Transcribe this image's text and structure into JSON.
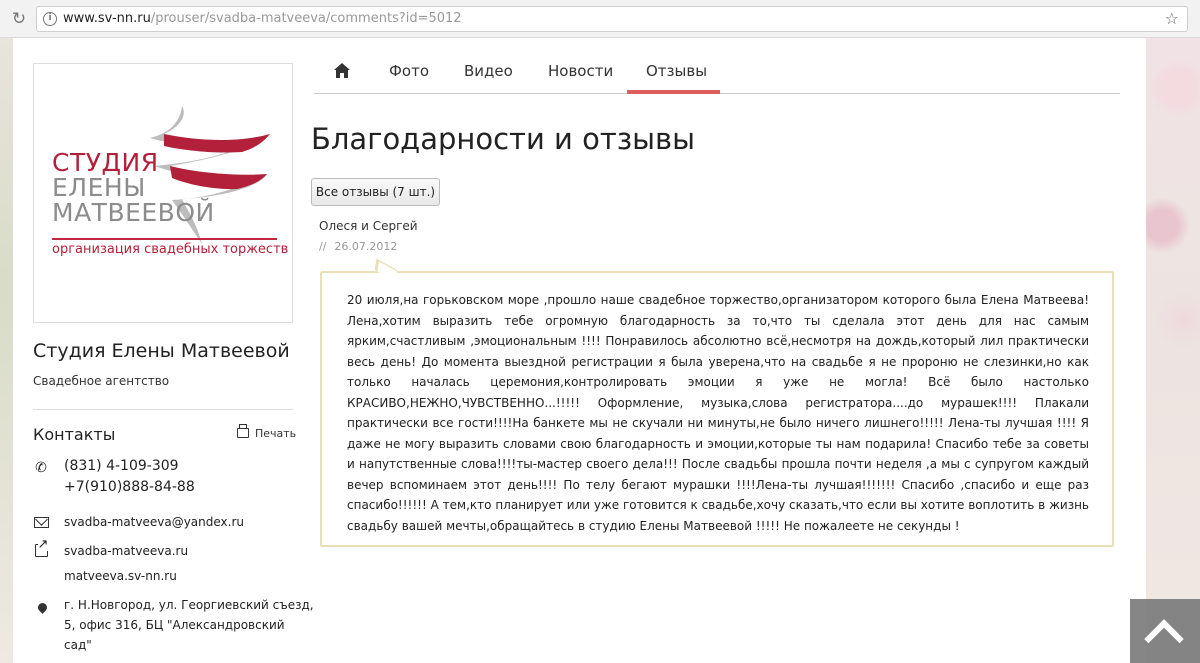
{
  "browser": {
    "url_host": "www.sv-nn.ru",
    "url_path": "/prouser/svadba-matveeva/comments?id=5012"
  },
  "logo": {
    "line1": "СТУДИЯ",
    "line2a": "ЕЛЕНЫ",
    "line2b": "МАТВЕЕВОЙ",
    "tagline": "организация свадебных торжеств",
    "accent_color": "#b3203a"
  },
  "sidebar": {
    "studio_name": "Студия Елены Матвеевой",
    "studio_type": "Свадебное агентство",
    "contacts_title": "Контакты",
    "print_label": "Печать",
    "phone1": "(831) 4-109-309",
    "phone2": "+7(910)888-84-88",
    "email": "svadba-matveeva@yandex.ru",
    "site1": "svadba-matveeva.ru",
    "site2": "matveeva.sv-nn.ru",
    "address_line1": "г. Н.Новгород, ул. Георгиевский съезд,",
    "address_line2": "5, офис 316, БЦ \"Александровский",
    "address_line3": "сад\""
  },
  "tabs": [
    {
      "label": "Фото"
    },
    {
      "label": "Видео"
    },
    {
      "label": "Новости"
    },
    {
      "label": "Отзывы",
      "active": true
    }
  ],
  "active_tab_color": "#e05c5c",
  "main": {
    "title": "Благодарности и отзывы",
    "all_reviews_button": "Все отзывы (7 шт.)"
  },
  "review": {
    "author": "Олеся и Сергей",
    "date_prefix": "//",
    "date": "26.07.2012",
    "text": "20 июля,на горьковском море ,прошло наше свадебное торжество,организатором которого была Елена Матвеева! Лена,хотим выразить тебе огромную благодарность за то,что ты сделала этот день для нас самым ярким,счастливым ,эмоциональным !!!! Понравилось абсолютно всё,несмотря на дождь,который лил практически весь день! До момента выездной регистрации я была уверена,что на свадьбе я не пророню не слезинки,но как только началась церемония,контролировать эмоции я уже не могла! Всё было настолько КРАСИВО,НЕЖНО,ЧУВСТВЕННО...!!!!! Оформление, музыка,слова регистратора....до мурашек!!!! Плакали практически все гости!!!!На банкете мы не скучали ни минуты,не было ничего лишнего!!!!! Лена-ты лучшая !!!! Я даже не могу выразить словами свою благодарность и эмоции,которые ты нам подарила! Спасибо тебе за советы и напутственные слова!!!!ты-мастер своего дела!!! После свадьбы прошла почти неделя ,а мы с супругом каждый вечер вспоминаем этот день!!!! По телу бегают мурашки !!!!Лена-ты лучшая!!!!!!! Спасибо ,спасибо и еще раз спасибо!!!!!! А тем,кто планирует или уже готовится к свадьбе,хочу сказать,что если вы хотите воплотить в жизнь свадьбу вашей мечты,обращайтесь в студию Елены Матвеевой !!!!! Не пожалеете не секунды !",
    "border_color": "#e8dfb8"
  }
}
